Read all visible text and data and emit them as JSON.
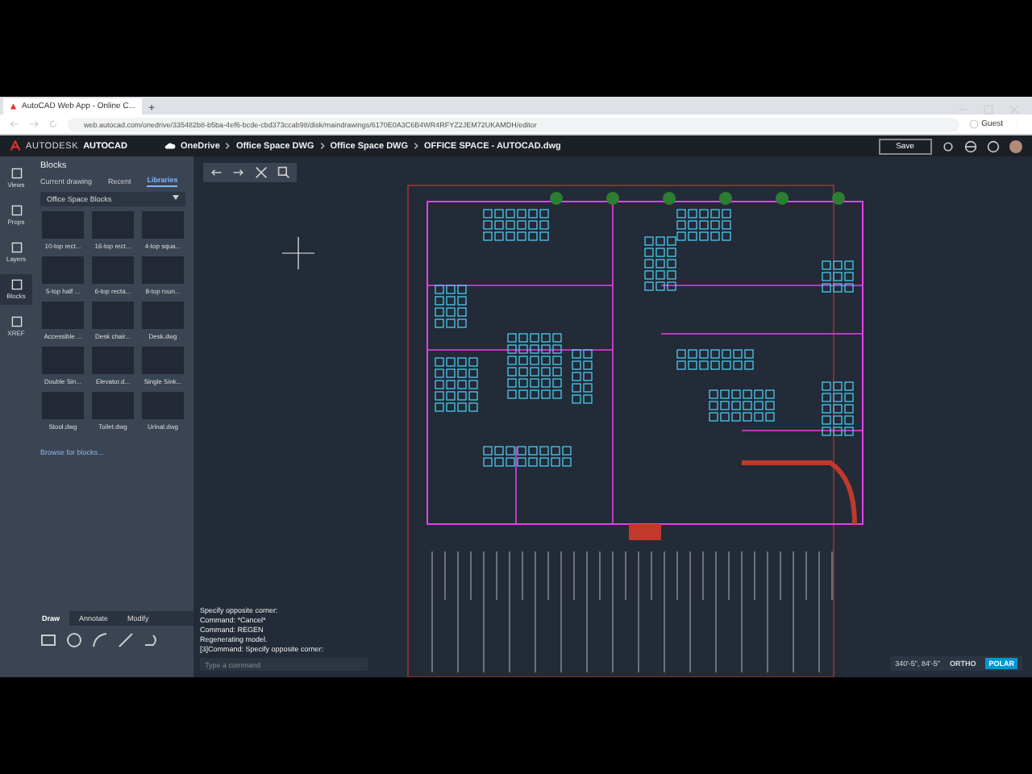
{
  "browser": {
    "tab_title": "AutoCAD Web App - Online C...",
    "new_tab": "+",
    "url": "web.autocad.com/onedrive/335482b8-b5ba-4ef6-bcde-cbd373ccab98/disk/maindrawings/6170E0A3C6B4WR4RFYZ2JEM72UKAMDH/editor",
    "profile": "Guest"
  },
  "app": {
    "brand_light": "AUTODESK",
    "brand_bold": "AUTOCAD",
    "breadcrumb": [
      "OneDrive",
      "Office Space DWG",
      "Office Space DWG",
      "OFFICE SPACE - AUTOCAD.dwg"
    ],
    "save": "Save"
  },
  "rail": [
    {
      "label": "Views",
      "selected": false
    },
    {
      "label": "Props",
      "selected": false
    },
    {
      "label": "Layers",
      "selected": false
    },
    {
      "label": "Blocks",
      "selected": true
    },
    {
      "label": "XREF",
      "selected": false
    }
  ],
  "blocks": {
    "title": "Blocks",
    "tabs": [
      {
        "label": "Current drawing",
        "selected": false
      },
      {
        "label": "Recent",
        "selected": false
      },
      {
        "label": "Libraries",
        "selected": true
      }
    ],
    "library": "Office Space Blocks",
    "items": [
      "10-top rect...",
      "16-top rect...",
      "4-top squa...",
      "5-top half ...",
      "6-top recta...",
      "8-top roun...",
      "Accessible ...",
      "Desk chair...",
      "Desk.dwg",
      "Double Sin...",
      "Elevator.d...",
      "Single Sink...",
      "Stool.dwg",
      "Toilet.dwg",
      "Urinal.dwg"
    ],
    "browse": "Browse for blocks..."
  },
  "tool_tabs": [
    {
      "label": "Draw",
      "selected": true
    },
    {
      "label": "Annotate",
      "selected": false
    },
    {
      "label": "Modify",
      "selected": false
    }
  ],
  "command": {
    "history": [
      "Specify opposite corner:",
      "Command: *Cancel*",
      "Command: REGEN",
      "Regenerating model.",
      "[3]Command: Specify opposite corner:"
    ],
    "placeholder": "Type a command"
  },
  "status": {
    "coords": "340'-5\", 84'-5\"",
    "toggles": [
      {
        "label": "ORTHO",
        "on": false
      },
      {
        "label": "POLAR",
        "on": true
      }
    ]
  }
}
